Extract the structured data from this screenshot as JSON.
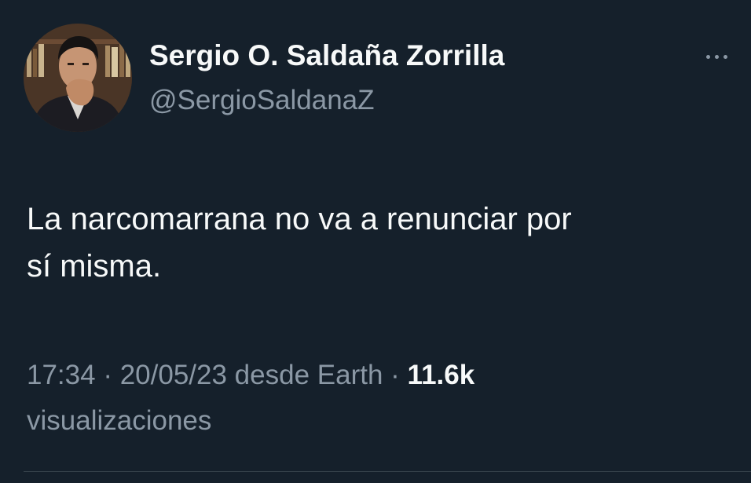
{
  "author": {
    "name": "Sergio O. Saldaña Zorrilla",
    "handle": "@SergioSaldanaZ"
  },
  "tweet": {
    "text_line1": "La narcomarrana no va a renunciar por",
    "text_line2": "sí misma."
  },
  "meta": {
    "time": "17:34",
    "separator1": " · ",
    "date": "20/05/23",
    "source": " desde Earth",
    "separator2": " · ",
    "views_count": "11.6k",
    "views_label": "visualizaciones"
  },
  "icons": {
    "more": "more-horizontal-icon"
  },
  "colors": {
    "background": "#15202b",
    "primary_text": "#f7f9f9",
    "secondary_text": "#8b98a5"
  }
}
